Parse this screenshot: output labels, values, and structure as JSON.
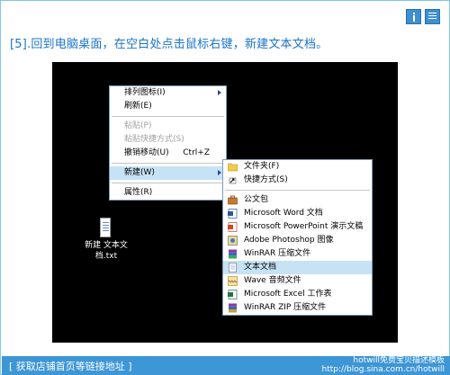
{
  "step_text": "[5].回到电脑桌面，在空白处点击鼠标右键，新建文本文档。",
  "context_menu": {
    "items": [
      {
        "label": "排列图标(I)",
        "arrow": true
      },
      {
        "label": "刷新(E)"
      },
      {
        "label": "粘贴(P)",
        "disabled": true
      },
      {
        "label": "粘贴快捷方式(S)",
        "disabled": true
      },
      {
        "label": "撤销移动(U)",
        "shortcut": "Ctrl+Z"
      },
      {
        "label": "新建(W)",
        "arrow": true,
        "highlight": true
      },
      {
        "label": "属性(R)"
      }
    ]
  },
  "new_submenu": {
    "items": [
      {
        "label": "文件夹(F)",
        "icon": "folder-icon"
      },
      {
        "label": "快捷方式(S)",
        "icon": "shortcut-icon"
      },
      {
        "label": "公文包",
        "icon": "briefcase-icon"
      },
      {
        "label": "Microsoft Word 文档",
        "icon": "word-icon"
      },
      {
        "label": "Microsoft PowerPoint 演示文稿",
        "icon": "powerpoint-icon"
      },
      {
        "label": "Adobe Photoshop 图像",
        "icon": "photoshop-icon"
      },
      {
        "label": "WinRAR 压缩文件",
        "icon": "winrar-icon"
      },
      {
        "label": "文本文档",
        "icon": "text-document-icon",
        "highlight": true
      },
      {
        "label": "Wave 音频文件",
        "icon": "wave-icon"
      },
      {
        "label": "Microsoft Excel 工作表",
        "icon": "excel-icon"
      },
      {
        "label": "WinRAR ZIP 压缩文件",
        "icon": "winrar-zip-icon"
      }
    ]
  },
  "desktop_file": {
    "label_line1": "新建 文本文",
    "label_line2": "档.txt"
  },
  "footer": {
    "left": "[ 获取店铺首页等链接地址 ]",
    "right_line1": "hotwill免费宝贝描述模板",
    "right_line2": "http://blog.sina.com.cn/hotwill"
  }
}
